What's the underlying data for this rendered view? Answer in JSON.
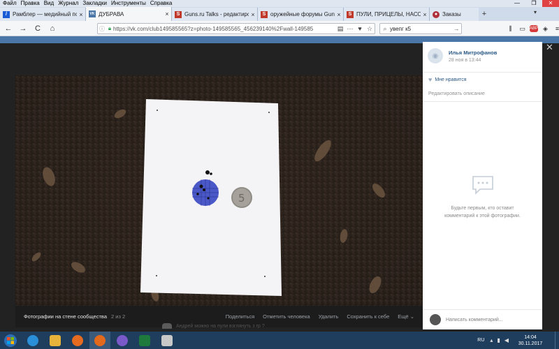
{
  "menubar": {
    "items": [
      "Файл",
      "Правка",
      "Вид",
      "Журнал",
      "Закладки",
      "Инструменты",
      "Справка"
    ]
  },
  "tabs": [
    {
      "title": "Рамблер — медийный портал",
      "icon_color": "#1a5bd6",
      "icon_char": "/"
    },
    {
      "title": "ДУБРАВА",
      "icon_color": "#4a76a8",
      "icon_char": "VK",
      "active": true
    },
    {
      "title": "Guns.ru Talks - редактирование",
      "icon_color": "#c0392b",
      "icon_char": "S"
    },
    {
      "title": "оружейные форумы Guns.ru",
      "icon_color": "#c0392b",
      "icon_char": "S"
    },
    {
      "title": "ПУЛИ, ПРИЦЕЛЫ, НАСОСЫ, С",
      "icon_color": "#c0392b",
      "icon_char": "S"
    },
    {
      "title": "Заказы",
      "icon_color": "#b0303a",
      "icon_char": "●"
    }
  ],
  "tab_new_label": "+",
  "tab_menu_label": "▾",
  "window_controls": [
    "—",
    "❐",
    "✕"
  ],
  "nav": {
    "back": "←",
    "forward": "→",
    "reload": "C",
    "home": "⌂",
    "url": "https://vk.com/club149585565?z=photo-149585565_456239140%2Fwall-149585",
    "reader_icon": "▤",
    "more_icon": "···",
    "pocket_icon": "♥",
    "bookmark_icon": "☆",
    "search_value": "увепг к5",
    "search_go": "→",
    "library_icon": "⫼",
    "sidebar_icon": "▭",
    "abp_label": "ABP",
    "ext_icon": "◈",
    "menu_icon": "≡"
  },
  "photo_bar": {
    "title": "Фотографии на стене сообщества",
    "count": "2 из 2",
    "actions": [
      "Поделиться",
      "Отметить человека",
      "Удалить",
      "Сохранить к себе",
      "Ещё ⌄"
    ]
  },
  "photo": {
    "coin_text": "5"
  },
  "side_panel": {
    "author": "Илья Митрофанов",
    "date": "28 ноя в 13:44",
    "like_label": "Мне нравится",
    "edit_label": "Редактировать описание",
    "empty_text": "Будьте первым, кто оставит комментарий к этой фотографии.",
    "comment_placeholder": "Написать комментарий..."
  },
  "close_label": "✕",
  "background_comment": "Андрей можно на пули взглянуть з гр ?",
  "taskbar": {
    "apps": [
      {
        "name": "ie",
        "color": "#2a8fd8"
      },
      {
        "name": "explorer",
        "color": "#e8b33a"
      },
      {
        "name": "media",
        "color": "#e46b1f"
      },
      {
        "name": "firefox",
        "color": "#e36a1c"
      },
      {
        "name": "viber",
        "color": "#7a5ac8"
      },
      {
        "name": "excel",
        "color": "#1e7a3c"
      },
      {
        "name": "paint",
        "color": "#c8c8c8"
      }
    ],
    "lang": "RU",
    "time": "14:04",
    "date": "30.11.2017"
  }
}
